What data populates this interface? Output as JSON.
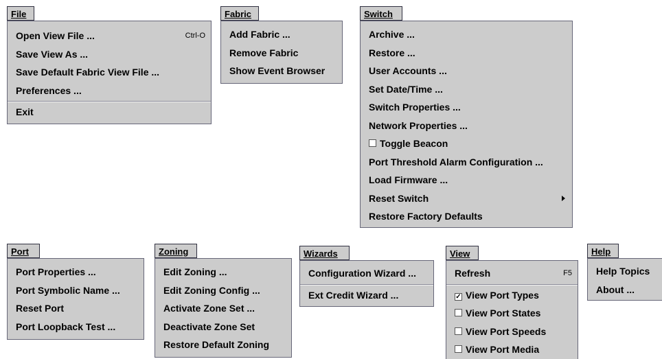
{
  "file": {
    "title": "File",
    "items": [
      "Open View File ...",
      "Save View As ...",
      "Save Default Fabric View File ...",
      "Preferences ..."
    ],
    "open_shortcut": "Ctrl-O",
    "exit": "Exit"
  },
  "fabric": {
    "title": "Fabric",
    "items": [
      "Add Fabric ...",
      "Remove Fabric",
      "Show Event Browser"
    ]
  },
  "switch": {
    "title": "Switch",
    "items": [
      "Archive ...",
      "Restore ...",
      "User Accounts ...",
      "Set Date/Time ...",
      "Switch Properties ...",
      "Network Properties ...",
      "Toggle Beacon",
      "Port Threshold Alarm Configuration ...",
      "Load Firmware ...",
      "Reset Switch",
      "Restore Factory Defaults"
    ]
  },
  "port": {
    "title": "Port",
    "items": [
      "Port Properties ...",
      "Port Symbolic Name ...",
      "Reset Port",
      "Port Loopback Test ..."
    ]
  },
  "zoning": {
    "title": "Zoning",
    "items": [
      "Edit Zoning ...",
      "Edit Zoning Config ...",
      "Activate Zone Set ...",
      "Deactivate Zone Set",
      "Restore Default Zoning"
    ]
  },
  "wizards": {
    "title": "Wizards",
    "items": [
      "Configuration Wizard ...",
      "Ext Credit Wizard ..."
    ]
  },
  "view": {
    "title": "View",
    "refresh": "Refresh",
    "refresh_shortcut": "F5",
    "items": [
      "View Port Types",
      "View Port States",
      "View Port Speeds",
      "View Port Media"
    ],
    "checked": [
      true,
      false,
      false,
      false
    ]
  },
  "help": {
    "title": "Help",
    "items": [
      "Help Topics",
      "About ..."
    ]
  },
  "colors": {
    "menu_bg": "#cccccc",
    "border": "#666678",
    "page_bg": "#ffffff"
  }
}
